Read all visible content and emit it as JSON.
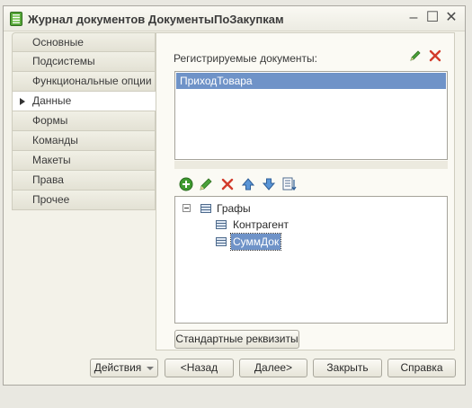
{
  "window": {
    "title": "Журнал документов ДокументыПоЗакупкам",
    "minimize_glyph": "–",
    "maximize_glyph": "☐",
    "close_glyph": "✕"
  },
  "tabs": [
    {
      "label": "Основные",
      "active": false
    },
    {
      "label": "Подсистемы",
      "active": false
    },
    {
      "label": "Функциональные опции",
      "active": false
    },
    {
      "label": "Данные",
      "active": true
    },
    {
      "label": "Формы",
      "active": false
    },
    {
      "label": "Команды",
      "active": false
    },
    {
      "label": "Макеты",
      "active": false
    },
    {
      "label": "Права",
      "active": false
    },
    {
      "label": "Прочее",
      "active": false
    }
  ],
  "data_panel": {
    "registered_label": "Регистрируемые документы:",
    "registered_items": [
      "ПриходТовара"
    ],
    "tree": {
      "root": "Графы",
      "children": [
        "Контрагент",
        "СуммДок"
      ]
    },
    "standard_attrs_button": "Стандартные реквизиты"
  },
  "footer": {
    "actions_label": "Действия",
    "back_label": "<Назад",
    "next_label": "Далее>",
    "close_label": "Закрыть",
    "help_label": "Справка"
  },
  "colors": {
    "selection": "#6f93c8",
    "add_green": "#3e9b2f",
    "delete_red": "#d23b2b",
    "arrow_blue": "#3f7dc8"
  }
}
